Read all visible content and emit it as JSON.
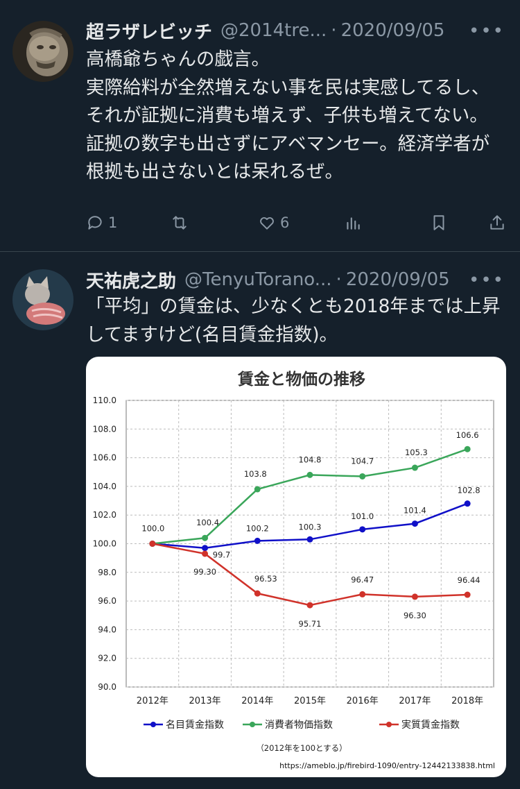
{
  "tweets": [
    {
      "name": "超ラザレビッチ",
      "handle": "@2014tre...",
      "date": "2020/09/05",
      "text": "高橋爺ちゃんの戯言。\n実際給料が全然増えない事を民は実感してるし、それが証拠に消費も増えず、子供も増えてない。\n証拠の数字も出さずにアベマンセー。経済学者が根拠も出さないとは呆れるぜ。",
      "reply_count": "1",
      "like_count": "6"
    },
    {
      "name": "天祐虎之助",
      "handle": "@TenyuTorano...",
      "date": "2020/09/05",
      "text": "「平均」の賃金は、少なくとも2018年までは上昇してますけど(名目賃金指数)。"
    }
  ],
  "separator_dot": "·",
  "more_glyph": "•••",
  "chart_data": {
    "type": "line",
    "title": "賃金と物価の推移",
    "categories": [
      "2012年",
      "2013年",
      "2014年",
      "2015年",
      "2016年",
      "2017年",
      "2018年"
    ],
    "ylim": [
      90,
      110
    ],
    "yticks": [
      "90.0",
      "92.0",
      "94.0",
      "96.0",
      "98.0",
      "100.0",
      "102.0",
      "104.0",
      "106.0",
      "108.0",
      "110.0"
    ],
    "grid": true,
    "legend_position": "bottom",
    "series": [
      {
        "name": "名目賃金指数",
        "color": "#1010c8",
        "values": [
          100.0,
          99.7,
          100.2,
          100.3,
          101.0,
          101.4,
          102.8
        ],
        "labels": [
          "",
          "99.7",
          "100.2",
          "100.3",
          "101.0",
          "101.4",
          "102.8"
        ]
      },
      {
        "name": "消費者物価指数",
        "color": "#3aa65a",
        "values": [
          100.0,
          100.4,
          103.8,
          104.8,
          104.7,
          105.3,
          106.6
        ],
        "labels": [
          "100.0",
          "100.4",
          "103.8",
          "104.8",
          "104.7",
          "105.3",
          "106.6"
        ]
      },
      {
        "name": "実質賃金指数",
        "color": "#d0322a",
        "values": [
          100.0,
          99.3,
          96.53,
          95.71,
          96.47,
          96.3,
          96.44
        ],
        "labels": [
          "",
          "99.30",
          "96.53",
          "95.71",
          "96.47",
          "96.30",
          "96.44"
        ]
      }
    ],
    "note": "（2012年を100とする）",
    "source": "https://ameblo.jp/firebird-1090/entry-12442133838.html"
  }
}
